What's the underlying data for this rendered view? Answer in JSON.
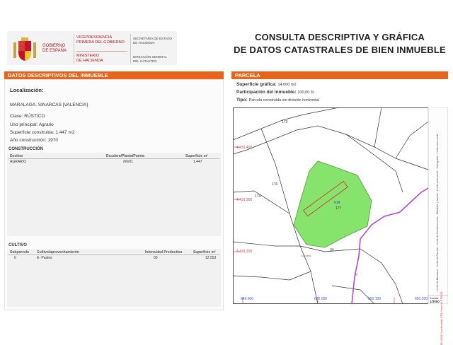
{
  "header": {
    "gobierno": [
      "GOBIERNO",
      "DE ESPAÑA"
    ],
    "vicepresidencia": [
      "VICEPRESIDENCIA",
      "PRIMERA DEL GOBIERNO"
    ],
    "ministerio": [
      "MINISTERIO",
      "DE HACIENDA"
    ],
    "secretaria": [
      "SECRETARÍA DE ESTADO",
      "DE HACIENDA"
    ],
    "direccion": [
      "DIRECCIÓN GENERAL",
      "DEL CATASTRO"
    ],
    "title_line1": "CONSULTA DESCRIPTIVA Y GRÁFICA",
    "title_line2": "DE DATOS CATASTRALES DE BIEN INMUEBLE"
  },
  "descriptive": {
    "bar": "DATOS DESCRIPTIVOS DEL INMUEBLE",
    "localizacion_label": "Localización:",
    "localizacion_value": "MARALAGA. SINARCAS [VALENCIA]",
    "clase_label": "Clase:",
    "clase_value": "RÚSTICO",
    "uso_label": "Uso principal:",
    "uso_value": "Agrario",
    "sup_label": "Superficie construida:",
    "sup_value": "1.447 m2",
    "anio_label": "Año construcción:",
    "anio_value": "1970",
    "construccion": {
      "title": "CONSTRUCCIÓN",
      "headers": [
        "Destino",
        "Escalera/Planta/Puerta",
        "Superficie m²"
      ],
      "rows": [
        [
          "AGRARIO",
          "/00/01",
          "1.447"
        ]
      ]
    },
    "cultivo": {
      "title": "CULTIVO",
      "headers": [
        "Subparcela",
        "Cultivo/aprovechamiento",
        "Intensidad Productiva",
        "Superficie m²"
      ],
      "rows": [
        [
          "0",
          "E- Pastos",
          "00",
          "12.553"
        ]
      ]
    }
  },
  "parcela": {
    "bar": "PARCELA",
    "sup_label": "Superficie gráfica:",
    "sup_value": "14.000 m2",
    "part_label": "Participación del inmueble:",
    "part_value": "100,00 %",
    "tipo_label": "Tipo:",
    "tipo_value": "Parcela construida sin división horizontal"
  },
  "map": {
    "parcel_numbers": [
      "173",
      "176",
      "174",
      "177",
      "34",
      "014"
    ],
    "y_coords": [
      "4.431.400",
      "4.431.300",
      "4.431.200"
    ],
    "x_coords": [
      "649.900",
      "650.000",
      "650.100",
      "650.200"
    ],
    "small_labels": [
      "Lindero",
      "6"
    ],
    "legend": [
      "Límite de Manzana",
      "Límite de Parcela",
      "Límite de Construcciones",
      "Mobiliario y aceras",
      "Límite zona verde",
      "Hidrografía",
      "Límite zona verde"
    ],
    "coord_note": "ED-2000 Coordenadas UTM, Huso 30 ETRS89",
    "escala_label": "Escala:",
    "escala_value": "1/3000",
    "colors": {
      "parcel_fill": "#86e36c",
      "road": "#b24ad8",
      "coord": "#d23a3a",
      "bar": "#e8641a"
    }
  }
}
